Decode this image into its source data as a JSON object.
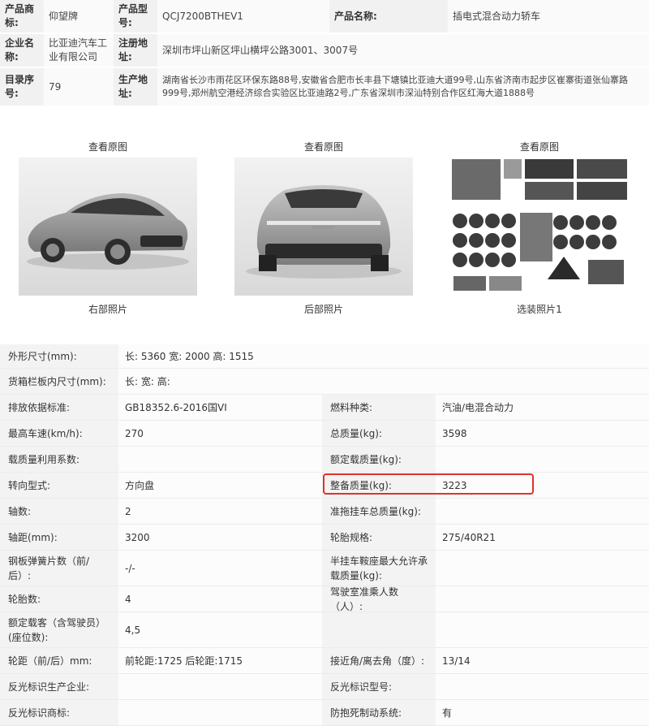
{
  "top_info": {
    "brand_label": "产品商标:",
    "brand_value": "仰望牌",
    "model_label": "产品型号:",
    "model_value": "QCJ7200BTHEV1",
    "name_label": "产品名称:",
    "name_value": "插电式混合动力轿车",
    "company_label": "企业名称:",
    "company_value": "比亚迪汽车工业有限公司",
    "reg_addr_label": "注册地址:",
    "reg_addr_value": "深圳市坪山新区坪山横坪公路3001、3007号",
    "catalog_label": "目录序号:",
    "catalog_value": "79",
    "prod_addr_label": "生产地址:",
    "prod_addr_value": "湖南省长沙市雨花区环保东路88号,安徽省合肥市长丰县下塘镇比亚迪大道99号,山东省济南市起步区崔寨街道张仙寨路999号,郑州航空港经济综合实验区比亚迪路2号,广东省深圳市深汕特别合作区红海大道1888号"
  },
  "photos": [
    {
      "link": "查看原图",
      "caption": "右部照片"
    },
    {
      "link": "查看原图",
      "caption": "后部照片"
    },
    {
      "link": "查看原图",
      "caption": "选装照片1"
    }
  ],
  "params": {
    "dimensions_label": "外形尺寸(mm):",
    "dimensions_value": "长: 5360 宽: 2000 高: 1515",
    "cargo_label": "货箱栏板内尺寸(mm):",
    "cargo_value": "长:  宽:  高:",
    "emission_label": "排放依据标准:",
    "emission_value": "GB18352.6-2016国VI",
    "fuel_label": "燃料种类:",
    "fuel_value": "汽油/电混合动力",
    "speed_label": "最高车速(km/h):",
    "speed_value": "270",
    "total_mass_label": "总质量(kg):",
    "total_mass_value": "3598",
    "mass_util_label": "载质量利用系数:",
    "mass_util_value": "",
    "rated_load_label": "额定载质量(kg):",
    "rated_load_value": "",
    "steering_label": "转向型式:",
    "steering_value": "方向盘",
    "curb_label": "整备质量(kg):",
    "curb_value": "3223",
    "axles_label": "轴数:",
    "axles_value": "2",
    "trailer_label": "准拖挂车总质量(kg):",
    "trailer_value": "",
    "wheelbase_label": "轴距(mm):",
    "wheelbase_value": "3200",
    "tire_label": "轮胎规格:",
    "tire_value": "275/40R21",
    "spring_label": "钢板弹簧片数（前/后）:",
    "spring_value": "-/-",
    "semi_label": "半挂车鞍座最大允许承载质量(kg):",
    "semi_value": "",
    "tires_label": "轮胎数:",
    "tires_value": "4",
    "cab_label": "驾驶室准乘人数（人）:",
    "cab_value": "",
    "seats_label": "额定载客（含驾驶员）(座位数):",
    "seats_value": "4,5",
    "track_label": "轮距（前/后）mm:",
    "track_value": "前轮距:1725 后轮距:1715",
    "angle_label": "接近角/离去角（度）:",
    "angle_value": "13/14",
    "reflect_company_label": "反光标识生产企业:",
    "reflect_company_value": "",
    "reflect_model_label": "反光标识型号:",
    "reflect_model_value": "",
    "reflect_brand_label": "反光标识商标:",
    "reflect_brand_value": "",
    "abs_label": "防抱死制动系统:",
    "abs_value": "有"
  },
  "colors": {
    "highlight": "#e0322a",
    "label_bg": "#f3f3f3",
    "value_bg": "#fcfcfc"
  }
}
